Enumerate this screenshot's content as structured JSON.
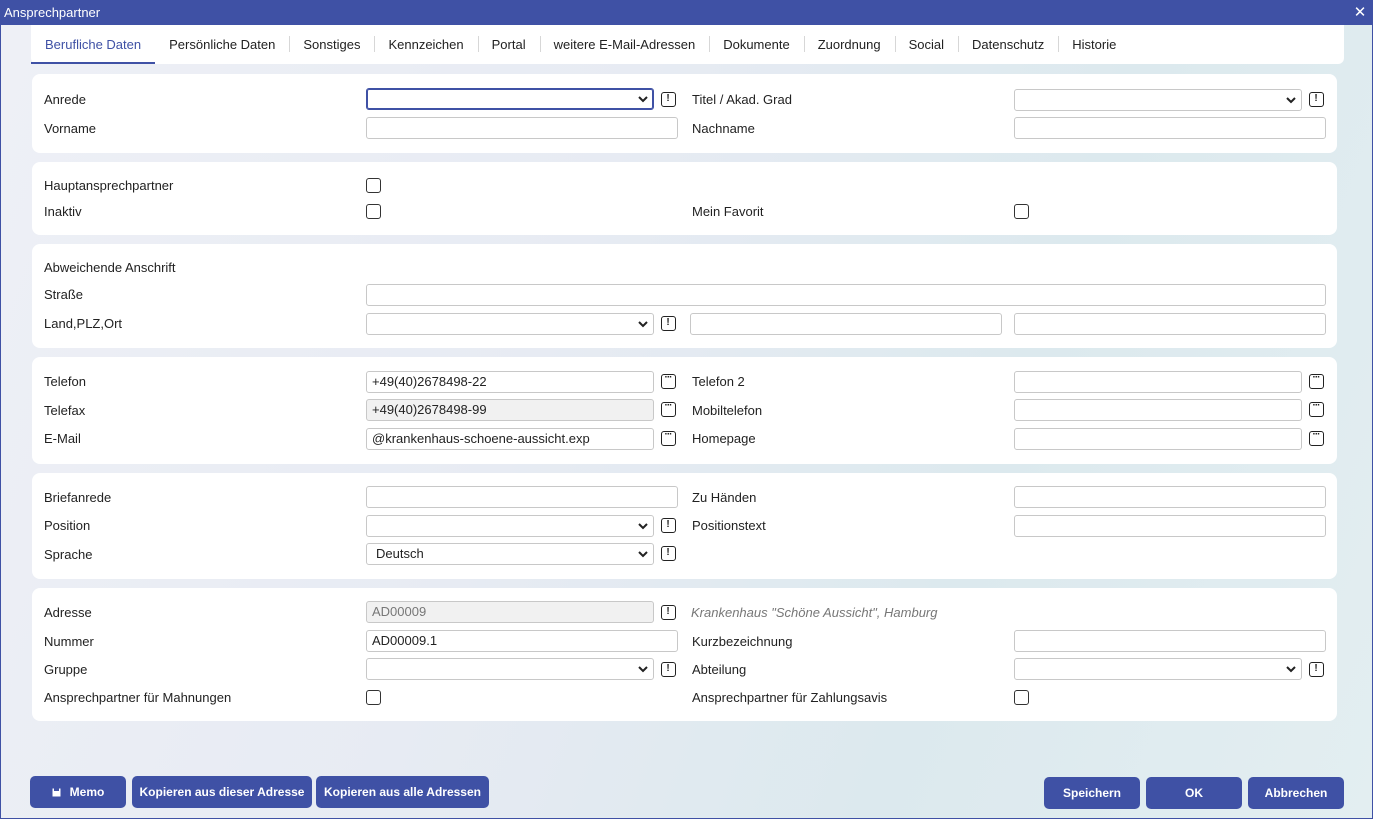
{
  "window": {
    "title": "Ansprechpartner",
    "close": "✕"
  },
  "tabs": [
    {
      "label": "Berufliche Daten",
      "active": true
    },
    {
      "label": "Persönliche Daten"
    },
    {
      "label": "Sonstiges"
    },
    {
      "label": "Kennzeichen"
    },
    {
      "label": "Portal"
    },
    {
      "label": "weitere E-Mail-Adressen"
    },
    {
      "label": "Dokumente"
    },
    {
      "label": "Zuordnung"
    },
    {
      "label": "Social"
    },
    {
      "label": "Datenschutz"
    },
    {
      "label": "Historie"
    }
  ],
  "name": {
    "anrede_label": "Anrede",
    "anrede_value": "",
    "titel_label": "Titel / Akad. Grad",
    "titel_value": "",
    "vorname_label": "Vorname",
    "vorname_value": "",
    "nachname_label": "Nachname",
    "nachname_value": ""
  },
  "flags": {
    "haupt_label": "Hauptansprechpartner",
    "inaktiv_label": "Inaktiv",
    "favorit_label": "Mein Favorit"
  },
  "anschrift": {
    "heading": "Abweichende Anschrift",
    "strasse_label": "Straße",
    "strasse_value": "",
    "land_label": "Land,PLZ,Ort",
    "land_value": "",
    "plz_value": "",
    "ort_value": ""
  },
  "kontakt": {
    "telefon_label": "Telefon",
    "telefon_value": "+49(40)2678498-22",
    "telefon2_label": "Telefon 2",
    "telefon2_value": "",
    "telefax_label": "Telefax",
    "telefax_value": "+49(40)2678498-99",
    "mobil_label": "Mobiltelefon",
    "mobil_value": "",
    "email_label": "E-Mail",
    "email_value": "@krankenhaus-schoene-aussicht.exp",
    "homepage_label": "Homepage",
    "homepage_value": ""
  },
  "brief": {
    "briefanrede_label": "Briefanrede",
    "briefanrede_value": "",
    "zuhaenden_label": "Zu Händen",
    "zuhaenden_value": "",
    "position_label": "Position",
    "position_value": "",
    "positionstext_label": "Positionstext",
    "positionstext_value": "",
    "sprache_label": "Sprache",
    "sprache_value": "Deutsch"
  },
  "adresse": {
    "adresse_label": "Adresse",
    "adresse_value": "AD00009",
    "adresse_name": "Krankenhaus \"Schöne Aussicht\", Hamburg",
    "nummer_label": "Nummer",
    "nummer_value": "AD00009.1",
    "kurz_label": "Kurzbezeichnung",
    "kurz_value": "",
    "gruppe_label": "Gruppe",
    "gruppe_value": "",
    "abteilung_label": "Abteilung",
    "abteilung_value": "",
    "mahnungen_label": "Ansprechpartner für Mahnungen",
    "zahlungsavis_label": "Ansprechpartner für Zahlungsavis"
  },
  "buttons": {
    "memo": "Memo",
    "kopieren_diese": "Kopieren aus dieser Adresse",
    "kopieren_alle": "Kopieren aus alle Adressen",
    "speichern": "Speichern",
    "ok": "OK",
    "abbrechen": "Abbrechen"
  },
  "icons": {
    "exclamation": "!",
    "dots": "···"
  },
  "colors": {
    "accent": "#3f51a5"
  }
}
